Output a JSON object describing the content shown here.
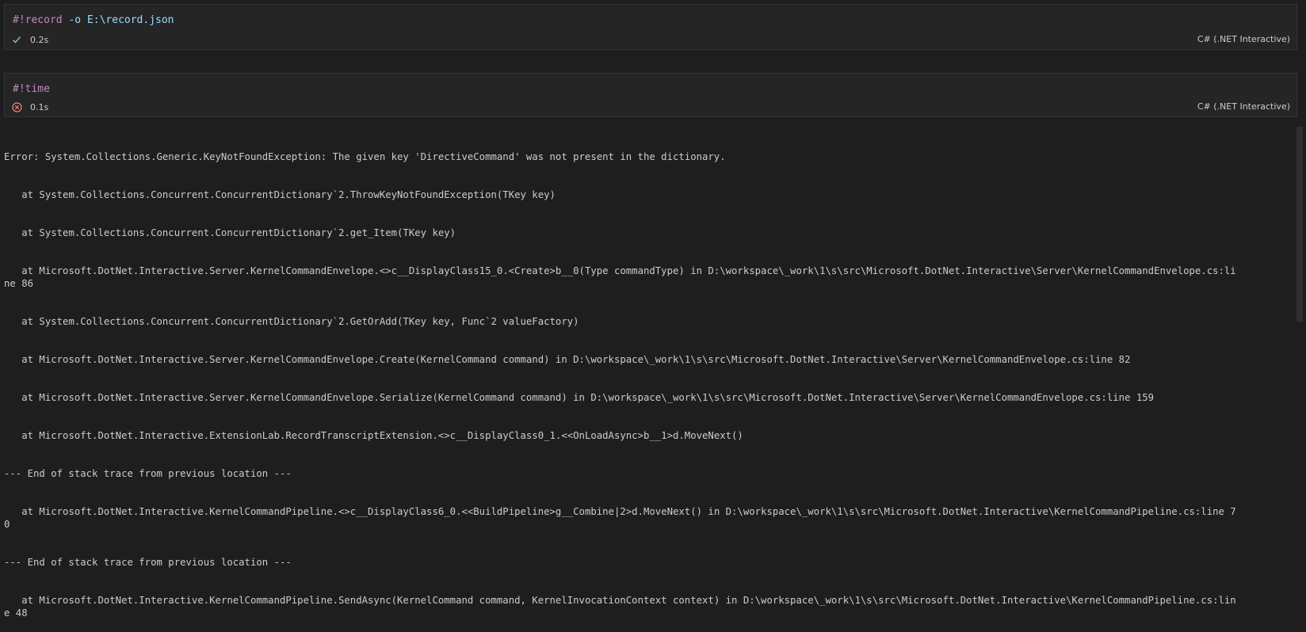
{
  "cells": [
    {
      "code_keyword": "#!record",
      "code_option": "-o",
      "code_arg": "E:\\record.json",
      "status_icon": "check-icon",
      "duration": "0.2s",
      "language": "C# (.NET Interactive)"
    },
    {
      "code_keyword": "#!time",
      "status_icon": "error-circle-icon",
      "duration": "0.1s",
      "language": "C# (.NET Interactive)"
    }
  ],
  "output_lines": [
    "Error: System.Collections.Generic.KeyNotFoundException: The given key 'DirectiveCommand' was not present in the dictionary.",
    "   at System.Collections.Concurrent.ConcurrentDictionary`2.ThrowKeyNotFoundException(TKey key)",
    "   at System.Collections.Concurrent.ConcurrentDictionary`2.get_Item(TKey key)",
    "   at Microsoft.DotNet.Interactive.Server.KernelCommandEnvelope.<>c__DisplayClass15_0.<Create>b__0(Type commandType) in D:\\workspace\\_work\\1\\s\\src\\Microsoft.DotNet.Interactive\\Server\\KernelCommandEnvelope.cs:line 86",
    "   at System.Collections.Concurrent.ConcurrentDictionary`2.GetOrAdd(TKey key, Func`2 valueFactory)",
    "   at Microsoft.DotNet.Interactive.Server.KernelCommandEnvelope.Create(KernelCommand command) in D:\\workspace\\_work\\1\\s\\src\\Microsoft.DotNet.Interactive\\Server\\KernelCommandEnvelope.cs:line 82",
    "   at Microsoft.DotNet.Interactive.Server.KernelCommandEnvelope.Serialize(KernelCommand command) in D:\\workspace\\_work\\1\\s\\src\\Microsoft.DotNet.Interactive\\Server\\KernelCommandEnvelope.cs:line 159",
    "   at Microsoft.DotNet.Interactive.ExtensionLab.RecordTranscriptExtension.<>c__DisplayClass0_1.<<OnLoadAsync>b__1>d.MoveNext()",
    "--- End of stack trace from previous location ---",
    "   at Microsoft.DotNet.Interactive.KernelCommandPipeline.<>c__DisplayClass6_0.<<BuildPipeline>g__Combine|2>d.MoveNext() in D:\\workspace\\_work\\1\\s\\src\\Microsoft.DotNet.Interactive\\KernelCommandPipeline.cs:line 70",
    "--- End of stack trace from previous location ---",
    "   at Microsoft.DotNet.Interactive.KernelCommandPipeline.SendAsync(KernelCommand command, KernelInvocationContext context) in D:\\workspace\\_work\\1\\s\\src\\Microsoft.DotNet.Interactive\\KernelCommandPipeline.cs:line 48"
  ],
  "colors": {
    "success": "#89d185",
    "error": "#f48771",
    "background": "#1e1e1e"
  }
}
